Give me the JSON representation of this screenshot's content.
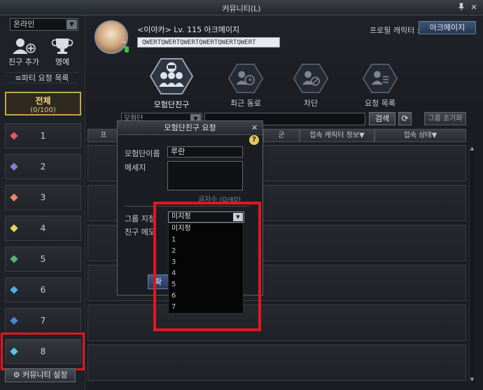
{
  "window": {
    "title": "커뮤니티(L)",
    "pin_icon": "pin-icon",
    "close_icon": "close-icon"
  },
  "sidebar": {
    "status": "온라인",
    "add_friend": "친구 추가",
    "honor": "명예",
    "party_list": "≡파티 요청 목록",
    "all_label": "전체",
    "all_count": "(0/100)",
    "groups": [
      {
        "label": "1",
        "color": "#e25b5b"
      },
      {
        "label": "2",
        "color": "#8f7bd1"
      },
      {
        "label": "3",
        "color": "#e98a5a"
      },
      {
        "label": "4",
        "color": "#e7d45a"
      },
      {
        "label": "5",
        "color": "#5ab07e"
      },
      {
        "label": "6",
        "color": "#4fb0e0"
      },
      {
        "label": "7",
        "color": "#4a86d9"
      },
      {
        "label": "8",
        "color": "#5cc8e8"
      }
    ],
    "settings": "커뮤니티 설정"
  },
  "header": {
    "char_info": "<이야카> Lv. 115 아크메이지",
    "status_message": "QWERTQWERTQWERTQWERTQWERTQWERT",
    "profile_label": "프로필 캐릭터 :",
    "profile_value": "아크메이지",
    "categories": [
      {
        "label": "모험단친구",
        "icon": "group-icon"
      },
      {
        "label": "최근 동료",
        "icon": "recent-users-icon"
      },
      {
        "label": "차단",
        "icon": "block-user-icon"
      },
      {
        "label": "요청 목록",
        "icon": "request-list-icon"
      }
    ]
  },
  "search": {
    "filter": "모험단",
    "button": "검색",
    "reset": "그룹 초기화"
  },
  "table": {
    "col_left": "프",
    "col_mid": "군",
    "col_char": "접속 캐릭터 정보▼",
    "col_status": "접속 상태▼"
  },
  "dialog": {
    "title": "모험단친구 요청",
    "name_label": "모험단이름",
    "name_value": "루란",
    "message_label": "메세지",
    "char_count": "글자수 (0/40)",
    "group_label": "그룹 지정",
    "memo_label": "친구 메모",
    "group_value": "미지정",
    "group_options": [
      "미지정",
      "1",
      "2",
      "3",
      "4",
      "5",
      "6",
      "7"
    ],
    "confirm": "확"
  },
  "colors": {
    "highlight": "#e0181f",
    "gold": "#c7a54a"
  }
}
